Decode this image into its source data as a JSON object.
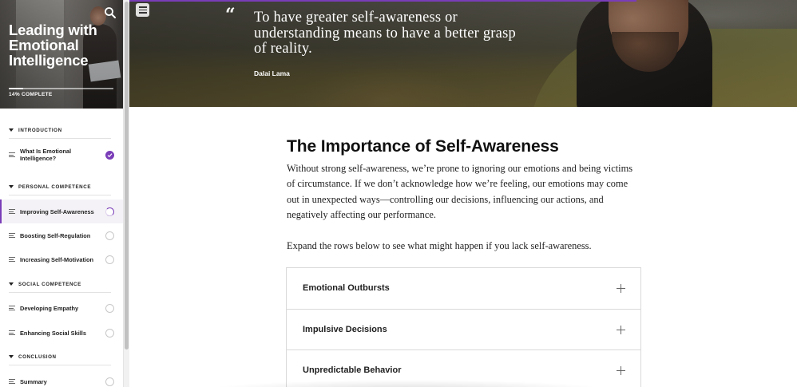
{
  "course": {
    "title": "Leading with Emotional Intelligence",
    "progress_label": "14% COMPLETE",
    "progress_fraction": 0.14
  },
  "sidebar": {
    "sections": [
      {
        "title": "INTRODUCTION",
        "lessons": [
          {
            "title": "What Is Emotional Intelligence?",
            "status": "complete"
          }
        ]
      },
      {
        "title": "PERSONAL COMPETENCE",
        "lessons": [
          {
            "title": "Improving Self-Awareness",
            "status": "in-progress"
          },
          {
            "title": "Boosting Self-Regulation",
            "status": "not-started"
          },
          {
            "title": "Increasing Self-Motivation",
            "status": "not-started"
          }
        ]
      },
      {
        "title": "SOCIAL COMPETENCE",
        "lessons": [
          {
            "title": "Developing Empathy",
            "status": "not-started"
          },
          {
            "title": "Enhancing Social Skills",
            "status": "not-started"
          }
        ]
      },
      {
        "title": "CONCLUSION",
        "lessons": [
          {
            "title": "Summary",
            "status": "not-started"
          }
        ]
      }
    ]
  },
  "banner": {
    "quote_mark": "“",
    "quote": "To have greater self-awareness or understanding means to have a better grasp of reality.",
    "author": "Dalai Lama"
  },
  "lesson": {
    "heading": "The Importance of Self-Awareness",
    "paragraph": "Without strong self-awareness, we’re prone to ignoring our emotions and being victims of circumstance. If we don’t acknowledge how we’re feeling, our emotions may come out in unexpected ways—controlling our decisions, influencing our actions, and negatively affecting our performance.",
    "instruction": "Expand the rows below to see what might happen if you lack self-awareness.",
    "accordion": [
      {
        "title": "Emotional Outbursts"
      },
      {
        "title": "Impulsive Decisions"
      },
      {
        "title": "Unpredictable Behavior"
      }
    ]
  },
  "icons": {
    "search": "search-icon",
    "menu": "hamburger-menu-icon",
    "lesson": "lesson-lines-icon",
    "complete": "check-circle-icon",
    "expand": "plus-icon",
    "section": "caret-down-icon"
  },
  "colors": {
    "accent": "#7a3db8",
    "text": "#1f1f1f",
    "border": "#d9d9d9"
  }
}
